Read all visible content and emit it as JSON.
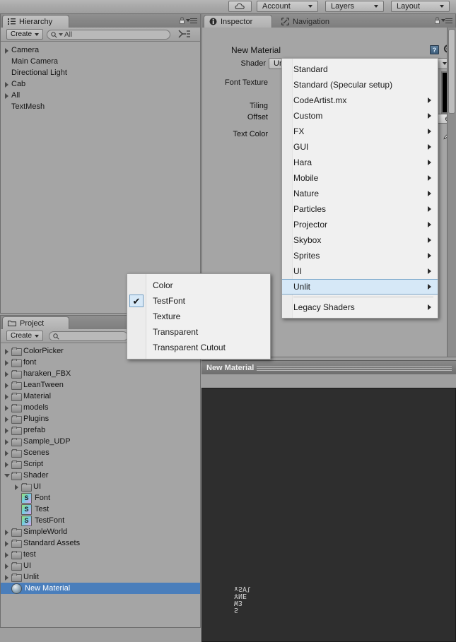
{
  "toolbar": {
    "cloud_label": "cloud-icon",
    "account": "Account",
    "layers": "Layers",
    "layout": "Layout"
  },
  "hierarchy": {
    "tab_label": "Hierarchy",
    "create_label": "Create",
    "search_value": "All",
    "items": [
      {
        "label": "Camera",
        "arrow": "closed",
        "indent": 0
      },
      {
        "label": "Main Camera",
        "arrow": "none",
        "indent": 0
      },
      {
        "label": "Directional Light",
        "arrow": "none",
        "indent": 0
      },
      {
        "label": "Cab",
        "arrow": "closed",
        "indent": 0
      },
      {
        "label": "All",
        "arrow": "closed",
        "indent": 0
      },
      {
        "label": "TextMesh",
        "arrow": "none",
        "indent": 0
      }
    ]
  },
  "project": {
    "tab_label": "Project",
    "create_label": "Create",
    "search_value": "",
    "items": [
      {
        "label": "ColorPicker",
        "type": "folder",
        "arrow": "closed",
        "indent": 0,
        "selected": false
      },
      {
        "label": "font",
        "type": "folder",
        "arrow": "closed",
        "indent": 0,
        "selected": false
      },
      {
        "label": "haraken_FBX",
        "type": "folder",
        "arrow": "closed",
        "indent": 0,
        "selected": false
      },
      {
        "label": "LeanTween",
        "type": "folder",
        "arrow": "closed",
        "indent": 0,
        "selected": false
      },
      {
        "label": "Material",
        "type": "folder",
        "arrow": "closed",
        "indent": 0,
        "selected": false
      },
      {
        "label": "models",
        "type": "folder",
        "arrow": "closed",
        "indent": 0,
        "selected": false
      },
      {
        "label": "Plugins",
        "type": "folder",
        "arrow": "closed",
        "indent": 0,
        "selected": false
      },
      {
        "label": "prefab",
        "type": "folder",
        "arrow": "closed",
        "indent": 0,
        "selected": false
      },
      {
        "label": "Sample_UDP",
        "type": "folder",
        "arrow": "closed",
        "indent": 0,
        "selected": false
      },
      {
        "label": "Scenes",
        "type": "folder",
        "arrow": "closed",
        "indent": 0,
        "selected": false
      },
      {
        "label": "Script",
        "type": "folder",
        "arrow": "closed",
        "indent": 0,
        "selected": false
      },
      {
        "label": "Shader",
        "type": "folder",
        "arrow": "open",
        "indent": 0,
        "selected": false
      },
      {
        "label": "UI",
        "type": "folder",
        "arrow": "closed",
        "indent": 1,
        "selected": false
      },
      {
        "label": "Font",
        "type": "shader",
        "arrow": "none",
        "indent": 1,
        "selected": false
      },
      {
        "label": "Test",
        "type": "shader",
        "arrow": "none",
        "indent": 1,
        "selected": false
      },
      {
        "label": "TestFont",
        "type": "shader",
        "arrow": "none",
        "indent": 1,
        "selected": false
      },
      {
        "label": "SimpleWorld",
        "type": "folder",
        "arrow": "closed",
        "indent": 0,
        "selected": false
      },
      {
        "label": "Standard Assets",
        "type": "folder",
        "arrow": "closed",
        "indent": 0,
        "selected": false
      },
      {
        "label": "test",
        "type": "folder",
        "arrow": "closed",
        "indent": 0,
        "selected": false
      },
      {
        "label": "UI",
        "type": "folder",
        "arrow": "closed",
        "indent": 0,
        "selected": false
      },
      {
        "label": "Unlit",
        "type": "folder",
        "arrow": "closed",
        "indent": 0,
        "selected": false
      },
      {
        "label": "New Material",
        "type": "material",
        "arrow": "none",
        "indent": 0,
        "selected": true
      }
    ]
  },
  "inspector": {
    "tab_label": "Inspector",
    "nav_tab_label": "Navigation",
    "material_name": "New Material",
    "shader_label": "Shader",
    "shader_value": "Unlit/TestFont",
    "properties": [
      {
        "label": "Font Texture"
      },
      {
        "label": "Tiling"
      },
      {
        "label": "Offset"
      },
      {
        "label": "Text Color"
      }
    ],
    "select_button": "ect",
    "help_icon": "?",
    "gear_icon": "gear-icon"
  },
  "shader_menu": {
    "items": [
      {
        "label": "Standard",
        "submenu": false,
        "highlighted": false,
        "separator_after": false
      },
      {
        "label": "Standard (Specular setup)",
        "submenu": false,
        "highlighted": false,
        "separator_after": false
      },
      {
        "label": "CodeArtist.mx",
        "submenu": true,
        "highlighted": false,
        "separator_after": false
      },
      {
        "label": "Custom",
        "submenu": true,
        "highlighted": false,
        "separator_after": false
      },
      {
        "label": "FX",
        "submenu": true,
        "highlighted": false,
        "separator_after": false
      },
      {
        "label": "GUI",
        "submenu": true,
        "highlighted": false,
        "separator_after": false
      },
      {
        "label": "Hara",
        "submenu": true,
        "highlighted": false,
        "separator_after": false
      },
      {
        "label": "Mobile",
        "submenu": true,
        "highlighted": false,
        "separator_after": false
      },
      {
        "label": "Nature",
        "submenu": true,
        "highlighted": false,
        "separator_after": false
      },
      {
        "label": "Particles",
        "submenu": true,
        "highlighted": false,
        "separator_after": false
      },
      {
        "label": "Projector",
        "submenu": true,
        "highlighted": false,
        "separator_after": false
      },
      {
        "label": "Skybox",
        "submenu": true,
        "highlighted": false,
        "separator_after": false
      },
      {
        "label": "Sprites",
        "submenu": true,
        "highlighted": false,
        "separator_after": false
      },
      {
        "label": "UI",
        "submenu": true,
        "highlighted": false,
        "separator_after": false
      },
      {
        "label": "Unlit",
        "submenu": true,
        "highlighted": true,
        "separator_after": true
      },
      {
        "label": "Legacy Shaders",
        "submenu": true,
        "highlighted": false,
        "separator_after": false
      }
    ]
  },
  "unlit_submenu": {
    "items": [
      {
        "label": "Color",
        "checked": false
      },
      {
        "label": "TestFont",
        "checked": true
      },
      {
        "label": "Texture",
        "checked": false
      },
      {
        "label": "Transparent",
        "checked": false
      },
      {
        "label": "Transparent Cutout",
        "checked": false
      }
    ],
    "check_glyph": "✔"
  },
  "preview": {
    "title": "New Material",
    "artifact_text": "S\nW3\n¥NE\nɤS∀l"
  },
  "colors": {
    "selection_blue": "#4a7ebb",
    "menu_highlight": "#d6e8f7",
    "panel_bg": "#a5a5a5",
    "preview_bg": "#2e2e2e"
  }
}
